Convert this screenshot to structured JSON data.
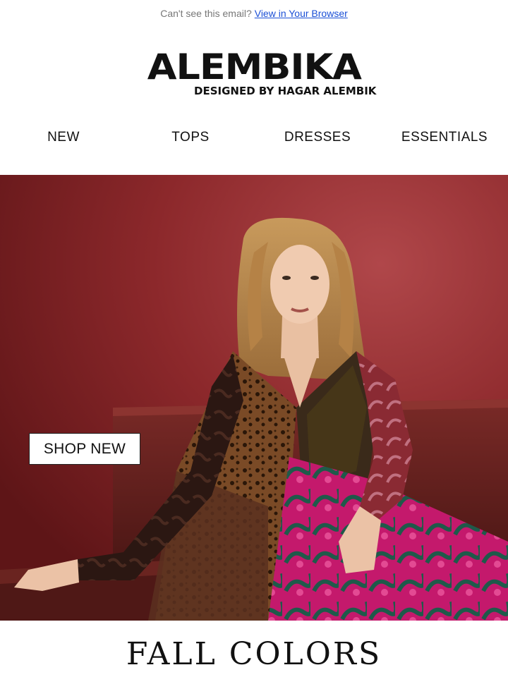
{
  "preheader": {
    "text": "Can't see this email?",
    "link_label": "View in Your Browser"
  },
  "brand": {
    "name": "ALEMBIKA",
    "tagline": "DESIGNED BY HAGAR ALEMBIK"
  },
  "nav": {
    "items": [
      "NEW",
      "TOPS",
      "DRESSES",
      "ESSENTIALS"
    ]
  },
  "hero": {
    "cta_label": "SHOP NEW",
    "image": "model-in-patchwork-velvet-dress-on-red-leather-banquette",
    "colors": {
      "wall": "#8a2528",
      "banquette": "#5a1e1c",
      "dress_pink": "#c8186f",
      "dress_green": "#1f5a4a",
      "dress_leopard": "#6b3e22"
    }
  },
  "section": {
    "title": "FALL COLORS"
  }
}
